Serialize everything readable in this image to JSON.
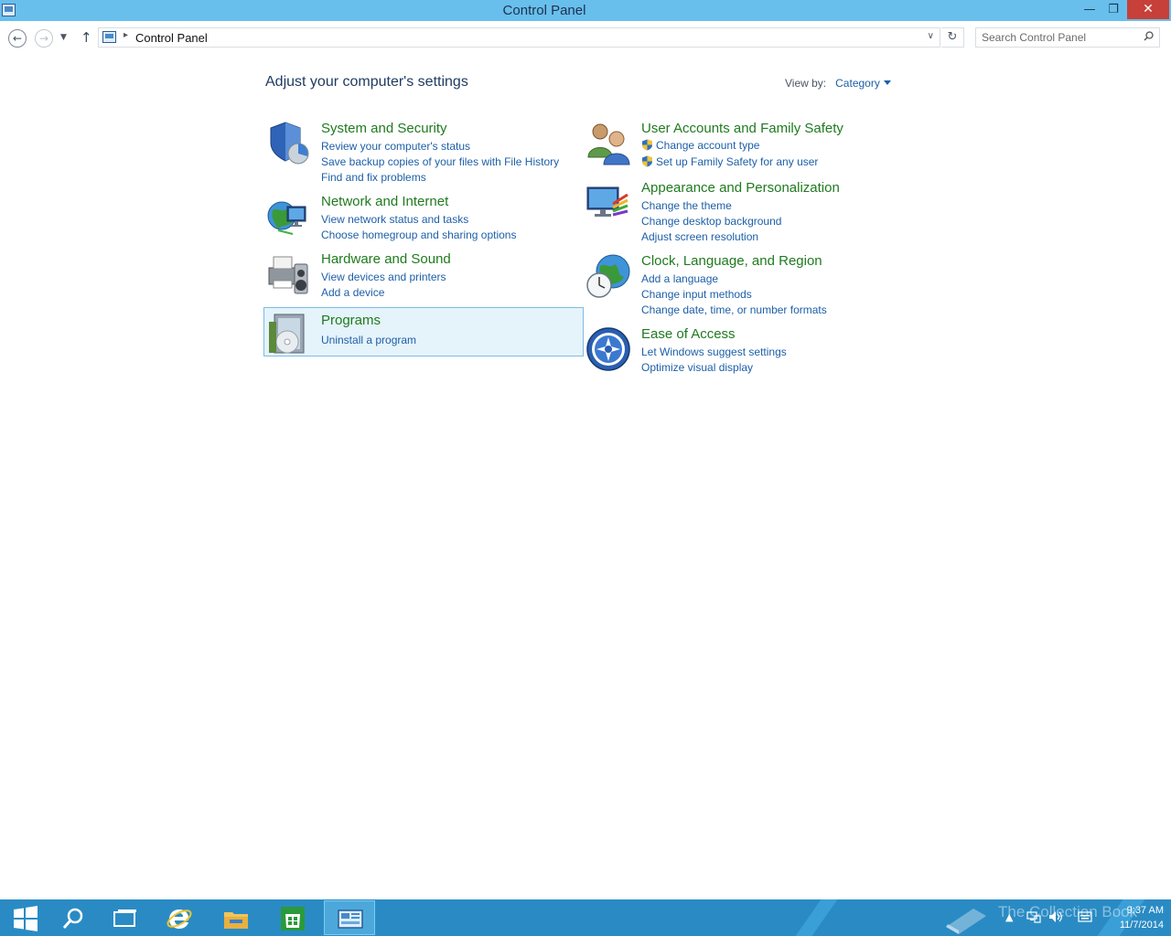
{
  "window": {
    "title": "Control Panel",
    "minimize_glyph": "—",
    "restore_glyph": "❐",
    "close_glyph": "✕"
  },
  "nav": {
    "back_glyph": "←",
    "forward_glyph": "→",
    "recent_glyph": "▼",
    "up_glyph": "↑",
    "breadcrumb": "Control Panel",
    "breadcrumb_sep": "▸",
    "dropdown_glyph": "∨",
    "refresh_glyph": "↻",
    "search_placeholder": "Search Control Panel"
  },
  "content": {
    "heading": "Adjust your computer's settings",
    "view_by_label": "View by:",
    "view_by_value": "Category"
  },
  "categories": {
    "system": {
      "title": "System and Security",
      "links": [
        "Review your computer's status",
        "Save backup copies of your files with File History",
        "Find and fix problems"
      ]
    },
    "network": {
      "title": "Network and Internet",
      "links": [
        "View network status and tasks",
        "Choose homegroup and sharing options"
      ]
    },
    "hardware": {
      "title": "Hardware and Sound",
      "links": [
        "View devices and printers",
        "Add a device"
      ]
    },
    "programs": {
      "title": "Programs",
      "links": [
        "Uninstall a program"
      ]
    },
    "users": {
      "title": "User Accounts and Family Safety",
      "links": [
        "Change account type",
        "Set up Family Safety for any user"
      ]
    },
    "appearance": {
      "title": "Appearance and Personalization",
      "links": [
        "Change the theme",
        "Change desktop background",
        "Adjust screen resolution"
      ]
    },
    "clock": {
      "title": "Clock, Language, and Region",
      "links": [
        "Add a language",
        "Change input methods",
        "Change date, time, or number formats"
      ]
    },
    "ease": {
      "title": "Ease of Access",
      "links": [
        "Let Windows suggest settings",
        "Optimize visual display"
      ]
    }
  },
  "taskbar": {
    "watermark": "The Collection Book",
    "time": "9:37 AM",
    "date": "11/7/2014"
  },
  "colors": {
    "titlebar": "#68bfec",
    "taskbar": "#2a8bc4",
    "category_title": "#1f7a1f",
    "link": "#1d5fa8"
  }
}
